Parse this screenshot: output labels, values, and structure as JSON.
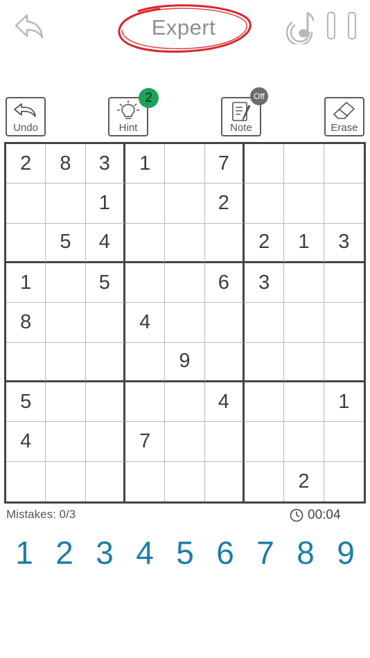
{
  "header": {
    "title": "Expert",
    "icons": {
      "back": "back-arrow-icon",
      "music": "music-note-icon",
      "pause": "pause-icon"
    },
    "title_circle_color": "#d9252b"
  },
  "toolbar": {
    "undo_label": "Undo",
    "hint_label": "Hint",
    "hint_count": "2",
    "note_label": "Note",
    "note_state": "Off",
    "erase_label": "Erase",
    "hint_badge_color": "#1aa55a"
  },
  "board": {
    "rows": [
      [
        "2",
        "8",
        "3",
        "1",
        "",
        "7",
        "",
        "",
        ""
      ],
      [
        "",
        "",
        "1",
        "",
        "",
        "2",
        "",
        "",
        ""
      ],
      [
        "",
        "5",
        "4",
        "",
        "",
        "",
        "2",
        "1",
        "3"
      ],
      [
        "1",
        "",
        "5",
        "",
        "",
        "6",
        "3",
        "",
        ""
      ],
      [
        "8",
        "",
        "",
        "4",
        "",
        "",
        "",
        "",
        ""
      ],
      [
        "",
        "",
        "",
        "",
        "9",
        "",
        "",
        "",
        ""
      ],
      [
        "5",
        "",
        "",
        "",
        "",
        "4",
        "",
        "",
        "1"
      ],
      [
        "4",
        "",
        "",
        "7",
        "",
        "",
        "",
        "",
        ""
      ],
      [
        "",
        "",
        "",
        "",
        "",
        "",
        "",
        "2",
        ""
      ]
    ]
  },
  "status": {
    "mistakes": "Mistakes: 0/3",
    "timer": "00:04"
  },
  "numpad": {
    "keys": [
      "1",
      "2",
      "3",
      "4",
      "5",
      "6",
      "7",
      "8",
      "9"
    ],
    "color": "#1b7ea6"
  }
}
